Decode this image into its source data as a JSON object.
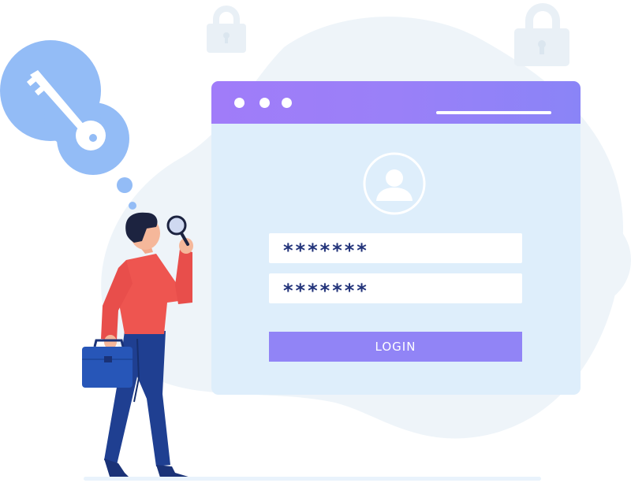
{
  "login_window": {
    "password_mask_1": "*******",
    "password_mask_2": "*******",
    "login_button": "LOGIN"
  },
  "icons": [
    "key-icon",
    "padlock-icon",
    "user-avatar-icon",
    "magnifying-glass-icon",
    "briefcase-icon"
  ],
  "colors": {
    "titlebar": "#9a80f8",
    "window_body": "#deeefb",
    "login_button": "#9184f6",
    "key_bubble": "#93bcf6",
    "password_text": "#22337a",
    "shirt": "#ee5550",
    "pants": "#1f3f91",
    "briefcase": "#2756b8"
  }
}
